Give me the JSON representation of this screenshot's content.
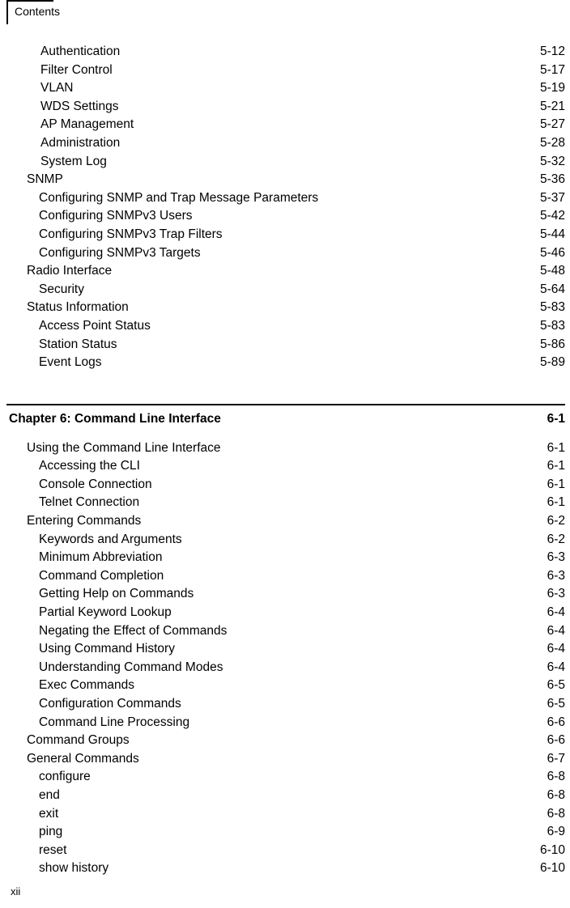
{
  "header": {
    "running_title": "Contents"
  },
  "footer": {
    "page_number": "xii"
  },
  "toc": {
    "section_1": [
      {
        "label": "Authentication",
        "page": "5-12",
        "level": 3
      },
      {
        "label": "Filter Control",
        "page": "5-17",
        "level": 3
      },
      {
        "label": "VLAN",
        "page": "5-19",
        "level": 3
      },
      {
        "label": "WDS Settings",
        "page": "5-21",
        "level": 3
      },
      {
        "label": "AP Management",
        "page": "5-27",
        "level": 3
      },
      {
        "label": "Administration",
        "page": "5-28",
        "level": 3
      },
      {
        "label": "System Log",
        "page": "5-32",
        "level": 3
      },
      {
        "label": "SNMP",
        "page": "5-36",
        "level": 1
      },
      {
        "label": "Configuring SNMP and Trap Message Parameters",
        "page": "5-37",
        "level": 2
      },
      {
        "label": "Configuring SNMPv3 Users",
        "page": "5-42",
        "level": 2
      },
      {
        "label": "Configuring SNMPv3 Trap Filters",
        "page": "5-44",
        "level": 2
      },
      {
        "label": "Configuring SNMPv3 Targets",
        "page": "5-46",
        "level": 2
      },
      {
        "label": "Radio Interface",
        "page": "5-48",
        "level": 1
      },
      {
        "label": "Security",
        "page": "5-64",
        "level": 2
      },
      {
        "label": "Status Information",
        "page": "5-83",
        "level": 1
      },
      {
        "label": "Access Point Status",
        "page": "5-83",
        "level": 2
      },
      {
        "label": "Station Status",
        "page": "5-86",
        "level": 2
      },
      {
        "label": "Event Logs",
        "page": "5-89",
        "level": 2
      }
    ],
    "chapter": {
      "title": "Chapter 6: Command Line Interface",
      "page": "6-1"
    },
    "section_2": [
      {
        "label": "Using the Command Line Interface",
        "page": "6-1",
        "level": 1
      },
      {
        "label": "Accessing the CLI",
        "page": "6-1",
        "level": 2
      },
      {
        "label": "Console Connection",
        "page": "6-1",
        "level": 2
      },
      {
        "label": "Telnet Connection",
        "page": "6-1",
        "level": 2
      },
      {
        "label": "Entering Commands",
        "page": "6-2",
        "level": 1
      },
      {
        "label": "Keywords and Arguments",
        "page": "6-2",
        "level": 2
      },
      {
        "label": "Minimum Abbreviation",
        "page": "6-3",
        "level": 2
      },
      {
        "label": "Command Completion",
        "page": "6-3",
        "level": 2
      },
      {
        "label": "Getting Help on Commands",
        "page": "6-3",
        "level": 2
      },
      {
        "label": "Partial Keyword Lookup",
        "page": "6-4",
        "level": 2
      },
      {
        "label": "Negating the Effect of Commands",
        "page": "6-4",
        "level": 2
      },
      {
        "label": "Using Command History",
        "page": "6-4",
        "level": 2
      },
      {
        "label": "Understanding Command Modes",
        "page": "6-4",
        "level": 2
      },
      {
        "label": "Exec Commands",
        "page": "6-5",
        "level": 2
      },
      {
        "label": "Configuration Commands",
        "page": "6-5",
        "level": 2
      },
      {
        "label": "Command Line Processing",
        "page": "6-6",
        "level": 2
      },
      {
        "label": "Command Groups",
        "page": "6-6",
        "level": 1
      },
      {
        "label": "General Commands",
        "page": "6-7",
        "level": 1
      },
      {
        "label": "configure",
        "page": "6-8",
        "level": 2
      },
      {
        "label": "end",
        "page": "6-8",
        "level": 2
      },
      {
        "label": "exit",
        "page": "6-8",
        "level": 2
      },
      {
        "label": "ping",
        "page": "6-9",
        "level": 2
      },
      {
        "label": "reset",
        "page": "6-10",
        "level": 2
      },
      {
        "label": "show history",
        "page": "6-10",
        "level": 2
      }
    ]
  }
}
